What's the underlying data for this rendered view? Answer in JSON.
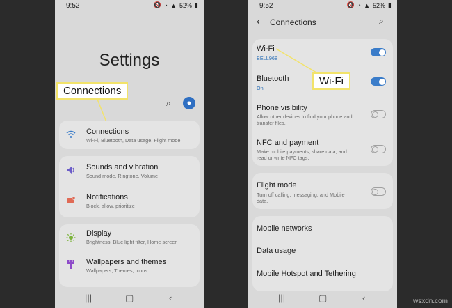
{
  "left": {
    "status": {
      "time": "9:52",
      "battery": "52%"
    },
    "title": "Settings",
    "callout": "Connections",
    "items": [
      {
        "label": "Connections",
        "sub": "Wi-Fi, Bluetooth, Data usage, Flight mode",
        "icon": "wifi-icon",
        "color": "#3a7cc9"
      },
      {
        "label": "Sounds and vibration",
        "sub": "Sound mode, Ringtone, Volume",
        "icon": "speaker-icon",
        "color": "#6c5dc8"
      },
      {
        "label": "Notifications",
        "sub": "Block, allow, prioritize",
        "icon": "notification-icon",
        "color": "#e06a55"
      },
      {
        "label": "Display",
        "sub": "Brightness, Blue light filter, Home screen",
        "icon": "sun-icon",
        "color": "#7bb33a"
      },
      {
        "label": "Wallpapers and themes",
        "sub": "Wallpapers, Themes, Icons",
        "icon": "brush-icon",
        "color": "#8e4bc9"
      }
    ]
  },
  "right": {
    "status": {
      "time": "9:52",
      "battery": "52%"
    },
    "header": {
      "title": "Connections"
    },
    "callout": "Wi-Fi",
    "wifi": {
      "label": "Wi-Fi",
      "sub": "BELL968"
    },
    "bluetooth": {
      "label": "Bluetooth",
      "sub": "On"
    },
    "visibility": {
      "label": "Phone visibility",
      "sub1": "Allow other devices to find your phone and",
      "sub2": "transfer files."
    },
    "nfc": {
      "label": "NFC and payment",
      "sub1": "Make mobile payments, share data, and",
      "sub2": "read or write NFC tags."
    },
    "flight": {
      "label": "Flight mode",
      "sub1": "Turn off calling, messaging, and Mobile",
      "sub2": "data."
    },
    "mobile_networks": "Mobile networks",
    "data_usage": "Data usage",
    "hotspot": "Mobile Hotspot and Tethering"
  },
  "watermark": "wsxdn.com",
  "toggles": {
    "wifi": true,
    "bluetooth": true,
    "visibility": false,
    "nfc": false,
    "flight": false
  }
}
